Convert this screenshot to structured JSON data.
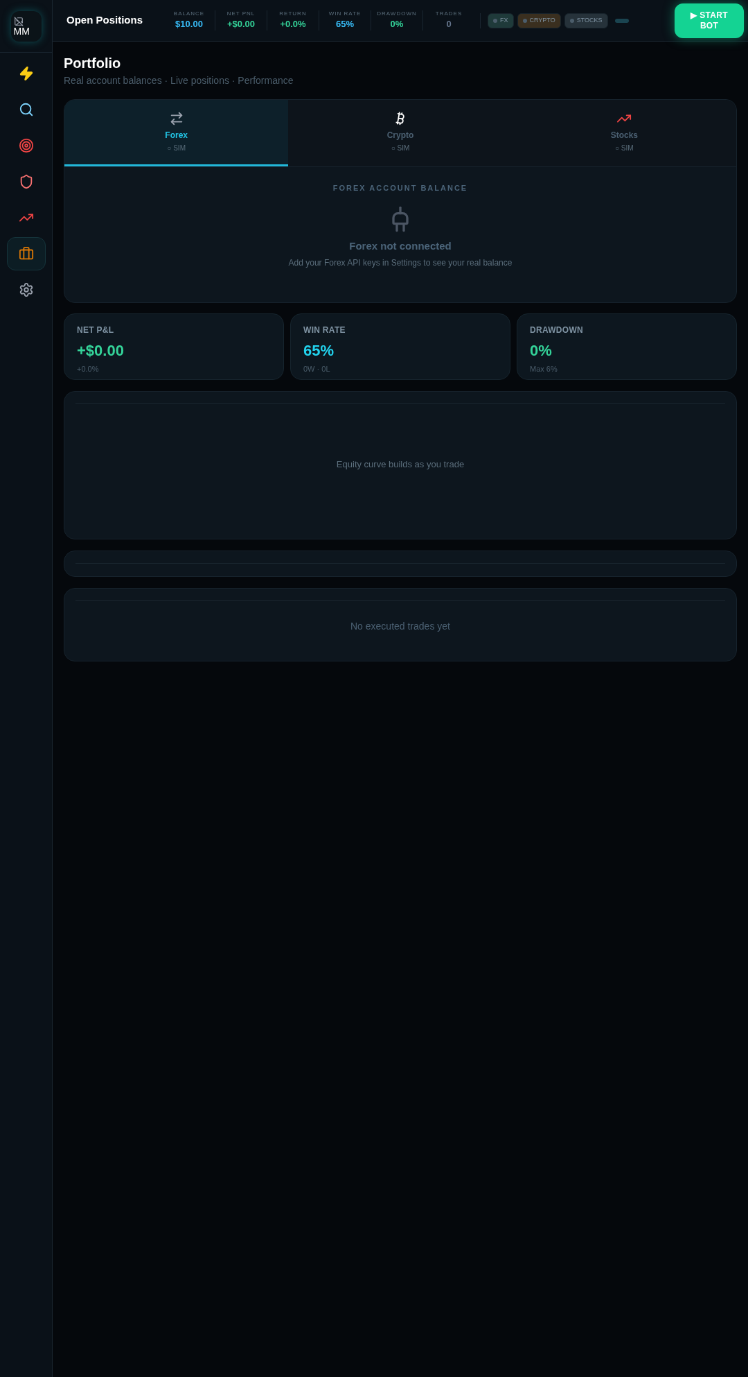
{
  "logo": {
    "alt": "MM"
  },
  "sidebar": {
    "items": [
      {
        "kind": "bolt",
        "selected": false
      },
      {
        "kind": "search",
        "selected": false
      },
      {
        "kind": "target",
        "selected": false
      },
      {
        "kind": "shield",
        "selected": false
      },
      {
        "kind": "chart",
        "selected": false
      },
      {
        "kind": "briefcase",
        "selected": true
      },
      {
        "kind": "settings",
        "selected": false
      }
    ]
  },
  "header": {
    "title": "Open Positions",
    "stats": [
      {
        "label": "BALANCE",
        "value": "$10.00",
        "color": "#38bdf8"
      },
      {
        "label": "NET PNL",
        "value": "+$0.00",
        "color": "#34d399"
      },
      {
        "label": "RETURN",
        "value": "+0.0%",
        "color": "#34d399"
      },
      {
        "label": "WIN RATE",
        "value": "65%",
        "color": "#38bdf8"
      },
      {
        "label": "DRAWDOWN",
        "value": "0%",
        "color": "#34d399"
      },
      {
        "label": "TRADES",
        "value": "0",
        "color": "#64748b"
      }
    ],
    "markets": [
      {
        "label": "FX",
        "color": "#1f3a3a"
      },
      {
        "label": "CRYPTO",
        "color": "#3a2f1f"
      },
      {
        "label": "STOCKS",
        "color": "#26323a"
      }
    ],
    "start_button": "▶ START BOT"
  },
  "page": {
    "title": "Portfolio",
    "subtitle": "Real account balances · Live positions · Performance"
  },
  "tabs": [
    {
      "label": "Forex",
      "sub": "○ SIM",
      "kind": "exchange",
      "selected": true
    },
    {
      "label": "Crypto",
      "sub": "○ SIM",
      "kind": "bitcoin",
      "selected": false
    },
    {
      "label": "Stocks",
      "sub": "○ SIM",
      "kind": "chart",
      "selected": false
    }
  ],
  "balance": {
    "heading": "FOREX ACCOUNT BALANCE",
    "status": "Forex not connected",
    "hint": "Add your Forex API keys in Settings to see your real balance"
  },
  "metrics": [
    {
      "label": "NET P&L",
      "value": "+$0.00",
      "sub": "+0.0%",
      "color": "#34d399"
    },
    {
      "label": "WIN RATE",
      "value": "65%",
      "sub": "0W · 0L",
      "color": "#22d3ee"
    },
    {
      "label": "DRAWDOWN",
      "value": "0%",
      "sub": "Max 6%",
      "color": "#34d399"
    }
  ],
  "equity": {
    "empty_text": "Equity curve builds as you trade"
  },
  "trades": {
    "empty_text": "No executed trades yet"
  }
}
